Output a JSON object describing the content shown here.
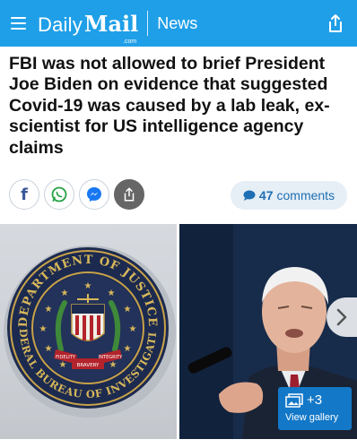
{
  "header": {
    "logo_daily": "Daily",
    "logo_mail": "Mail",
    "logo_dotcom": ".com",
    "section": "News",
    "brand_color": "#1f9fe8"
  },
  "article": {
    "headline": "FBI was not allowed to brief President Joe Biden on evidence that suggested Covid-19 was caused by a lab leak, ex-scientist for US intelligence agency claims"
  },
  "social": {
    "buttons": [
      "facebook-icon",
      "whatsapp-icon",
      "messenger-icon",
      "share-icon"
    ]
  },
  "comments": {
    "count": "47",
    "label": "comments"
  },
  "gallery": {
    "seal_text_top": "DEPARTMENT OF JUSTICE",
    "seal_text_bottom": "FEDERAL BUREAU OF INVESTIGATION",
    "seal_ribbon": [
      "FIDELITY",
      "BRAVERY",
      "INTEGRITY"
    ],
    "more_count": "+3",
    "view_label": "View gallery"
  }
}
